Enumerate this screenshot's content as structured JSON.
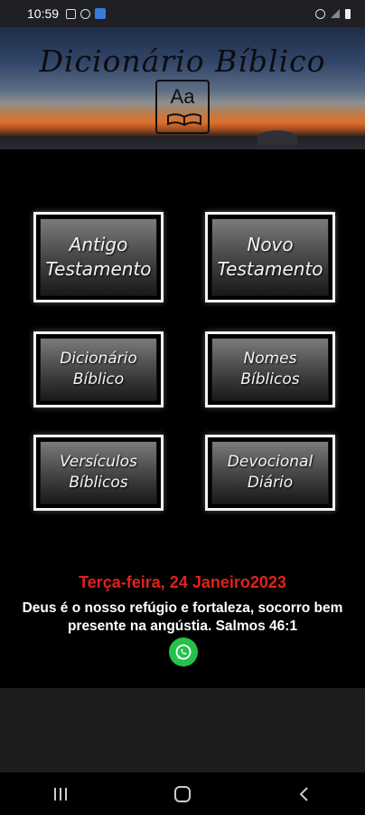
{
  "status_bar": {
    "time": "10:59"
  },
  "header": {
    "title": "Dicionário Bíblico",
    "logo_text": "Aa"
  },
  "menu": {
    "antigo": {
      "line1": "Antigo",
      "line2": "Testamento"
    },
    "novo": {
      "line1": "Novo",
      "line2": "Testamento"
    },
    "dicionario": {
      "line1": "Dicionário",
      "line2": "Bíblico"
    },
    "nomes": {
      "line1": "Nomes",
      "line2": "Bíblicos"
    },
    "versiculos": {
      "line1": "Versículos",
      "line2": "Bíblicos"
    },
    "devocional": {
      "line1": "Devocional",
      "line2": "Diário"
    }
  },
  "verse": {
    "date": "Terça-feira, 24 Janeiro2023",
    "text": "Deus é o nosso refúgio e fortaleza, socorro bem presente na angústia. Salmos 46:1"
  },
  "colors": {
    "date_red": "#e0221c",
    "whatsapp_green": "#25c24b"
  }
}
